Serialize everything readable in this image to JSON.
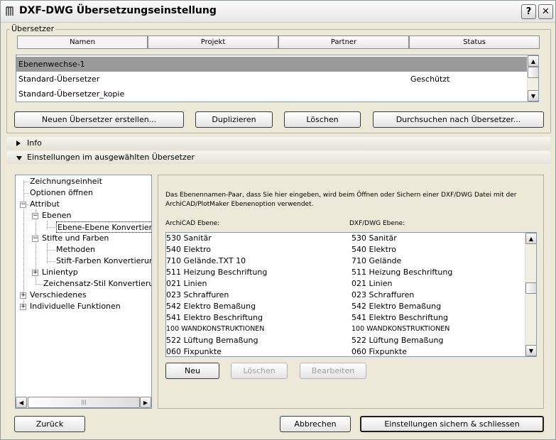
{
  "window": {
    "title": "DXF-DWG Übersetzungseinstellung",
    "help_label": "?",
    "close_label": "✕"
  },
  "translators_group": {
    "label": "Übersetzer",
    "columns": [
      "Namen",
      "Projekt",
      "Partner",
      "Status"
    ],
    "rows": [
      {
        "name": "Ebenenwechse-1",
        "status": ""
      },
      {
        "name": "Standard-Übersetzer",
        "status": "Geschützt"
      },
      {
        "name": "Standard-Übersetzer_kopie",
        "status": ""
      }
    ],
    "buttons": {
      "new": "Neuen Übersetzer erstellen...",
      "duplicate": "Duplizieren",
      "delete": "Löschen",
      "browse": "Durchsuchen nach Übersetzer..."
    }
  },
  "info_section": {
    "label": "Info"
  },
  "settings_section": {
    "label": "Einstellungen im ausgewählten Übersetzer"
  },
  "tree": {
    "items": [
      "Zeichnungseinheit",
      "Optionen öffnen",
      "Attribut",
      "Ebenen",
      "Ebene-Ebene Konvertierung",
      "Stifte und Farben",
      "Methoden",
      "Stift-Farben Konvertierung",
      "Linientyp",
      "Zeichensatz-Stil Konvertierung",
      "Verschiedenes",
      "Individuelle Funktionen"
    ],
    "expander_minus": "−",
    "expander_plus": "+",
    "scroll_grip": "|||"
  },
  "panel": {
    "description": "Das Ebenennamen-Paar, dass Sie hier eingeben, wird beim Öffnen oder Sichern einer DXF/DWG Datei mit der ArchiCAD/PlotMaker Ebenenoption verwendet.",
    "col_archicad": "ArchiCAD Ebene:",
    "col_dxf": "DXF/DWG Ebene:",
    "pairs": [
      {
        "archicad": "530 Sanitär",
        "dxf": "530 Sanitär"
      },
      {
        "archicad": "540 Elektro",
        "dxf": "540 Elektro"
      },
      {
        "archicad": "710 Gelände.TXT 10",
        "dxf": "710 Gelände"
      },
      {
        "archicad": "511 Heizung Beschriftung",
        "dxf": "511 Heizung Beschriftung"
      },
      {
        "archicad": "021 Linien",
        "dxf": "021 Linien"
      },
      {
        "archicad": "023 Schraffuren",
        "dxf": "023 Schraffuren"
      },
      {
        "archicad": "542 Elektro Bemaßung",
        "dxf": "542 Elektro Bemaßung"
      },
      {
        "archicad": "541 Elektro Beschriftung",
        "dxf": "541 Elektro Beschriftung"
      },
      {
        "archicad": "100 WANDKONSTRUKTIONEN",
        "dxf": "100 WANDKONSTRUKTIONEN"
      },
      {
        "archicad": "522 Lüftung Bemaßung",
        "dxf": "522 Lüftung Bemaßung"
      },
      {
        "archicad": "060 Fixpunkte",
        "dxf": "060 Fixpunkte"
      }
    ],
    "buttons": {
      "new": "Neu",
      "delete": "Löschen",
      "edit": "Bearbeiten"
    }
  },
  "footer": {
    "back": "Zurück",
    "cancel": "Abbrechen",
    "save": "Einstellungen sichern & schliessen"
  },
  "icons": {
    "up": "▲",
    "down": "▼",
    "left": "◀",
    "right": "▶"
  }
}
